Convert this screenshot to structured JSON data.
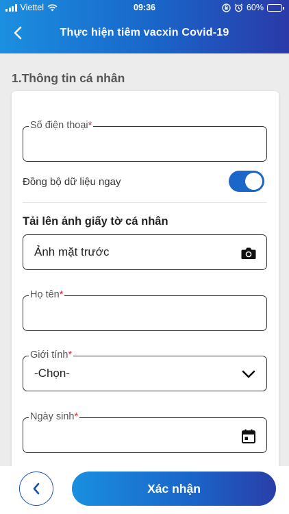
{
  "status_bar": {
    "carrier": "Viettel",
    "time": "09:36",
    "battery": "60%"
  },
  "header": {
    "title": "Thực hiện tiêm vacxin Covid-19"
  },
  "section": {
    "title": "1.Thông tin cá nhân"
  },
  "form": {
    "phone": {
      "label": "Số điện thoại",
      "required": "*",
      "value": ""
    },
    "sync": {
      "label": "Đồng bộ dữ liệu ngay",
      "enabled": true
    },
    "upload_title": "Tải lên ảnh giấy tờ cá nhân",
    "front_photo": {
      "value": "Ảnh mặt trước"
    },
    "full_name": {
      "label": "Họ tên",
      "required": "*",
      "value": ""
    },
    "gender": {
      "label": "Giới tính",
      "required": "*",
      "value": "-Chọn-"
    },
    "birthday": {
      "label": "Ngày sinh",
      "required": "*",
      "value": ""
    }
  },
  "footer": {
    "confirm_label": "Xác nhận"
  },
  "colors": {
    "primary": "#1a66c9",
    "required": "#e5293a"
  }
}
